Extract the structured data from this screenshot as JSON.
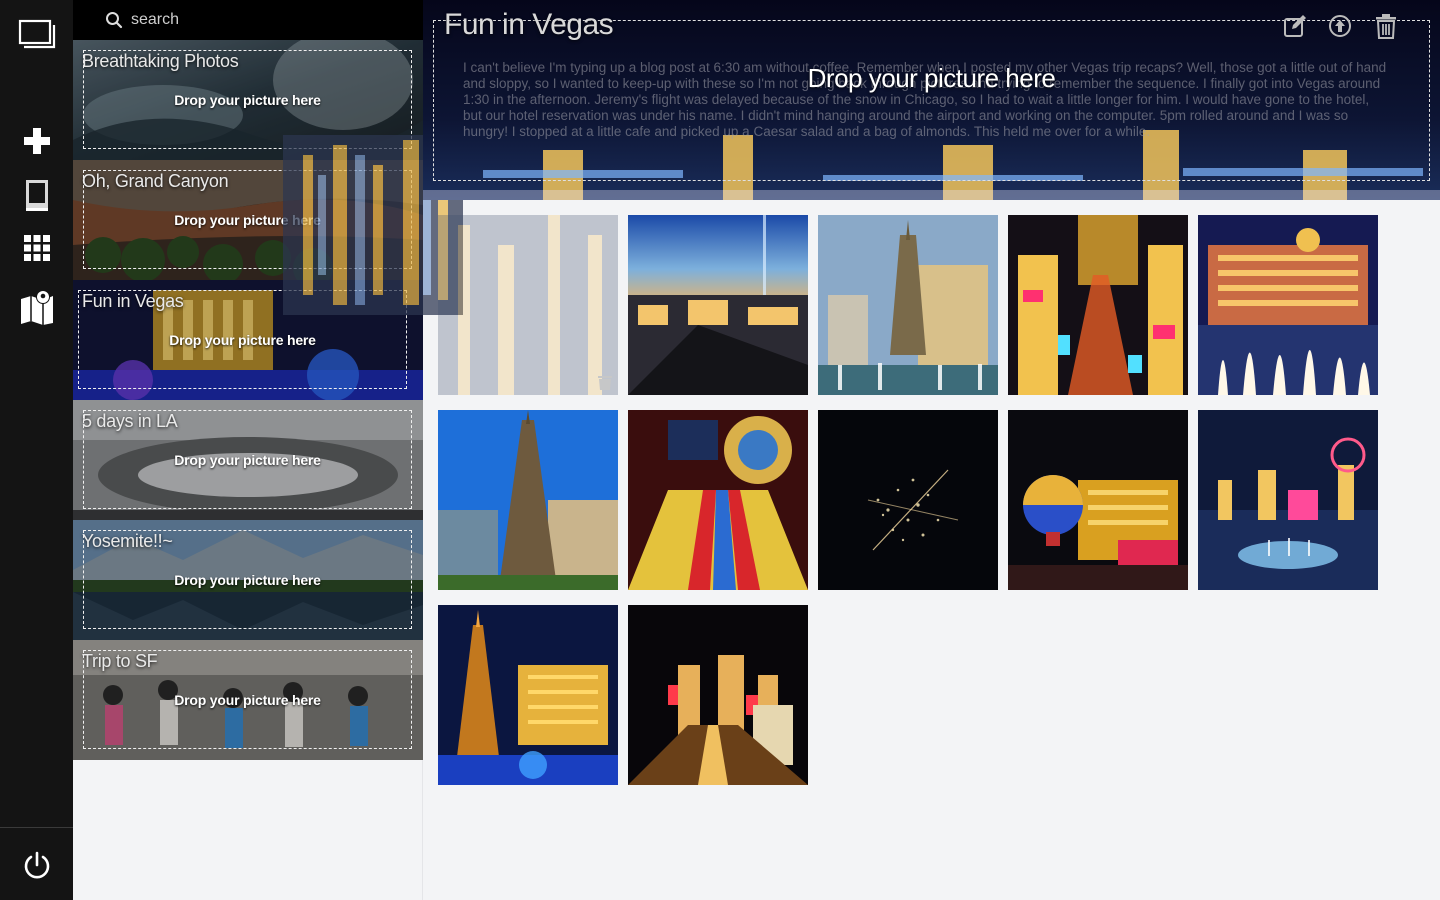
{
  "search": {
    "placeholder": "search"
  },
  "rail": {
    "icons": [
      "photos-icon",
      "add-icon",
      "albums-icon",
      "grid-icon",
      "map-icon",
      "power-icon"
    ]
  },
  "albums": [
    {
      "title": "Breathtaking Photos",
      "drop_label": "Drop your picture here"
    },
    {
      "title": "Oh, Grand Canyon",
      "drop_label": "Drop your picture here"
    },
    {
      "title": "Fun in Vegas",
      "drop_label": "Drop your picture here"
    },
    {
      "title": "5 days in LA",
      "drop_label": "Drop your picture here"
    },
    {
      "title": "Yosemite!!~",
      "drop_label": "Drop your picture here"
    },
    {
      "title": "Trip to SF",
      "drop_label": "Drop your picture here"
    }
  ],
  "header": {
    "title": "Fun in Vegas",
    "drop_label": "Drop your picture here",
    "description": "I can't believe I'm typing up a blog post at 6:30 am without coffee. Remember when I posted my other Vegas trip recaps? Well, those got a little out of hand and sloppy, so I wanted to keep-up with these so I'm not going back through pictures and trying to remember the sequence. I finally got into Vegas around 1:30 in the afternoon. Jeremy's flight was delayed because of the snow in Chicago, so I had to wait a little longer for him. I would have gone to the hotel, but our hotel reservation was under his name. I didn't mind hanging around the airport and working on the computer. 5pm rolled around and I was so hungry! I stopped at a little cafe and picked up a Caesar salad and a bag of almonds. This held me over for a while."
  },
  "photos": [
    {
      "name": "strip-aerial-faded"
    },
    {
      "name": "luxor-dusk"
    },
    {
      "name": "paris-eiffel-day"
    },
    {
      "name": "strip-night-mgm"
    },
    {
      "name": "bellagio-fountains"
    },
    {
      "name": "eiffel-blue-sky"
    },
    {
      "name": "slot-machine-wheel"
    },
    {
      "name": "city-lights-from-space"
    },
    {
      "name": "paris-balloon-night"
    },
    {
      "name": "strip-panorama-night"
    },
    {
      "name": "eiffel-night-aerial"
    },
    {
      "name": "strip-street-night"
    }
  ],
  "colors": {
    "rail": "#141414",
    "panel": "#f3f4f6",
    "accent": "#ffffff"
  }
}
